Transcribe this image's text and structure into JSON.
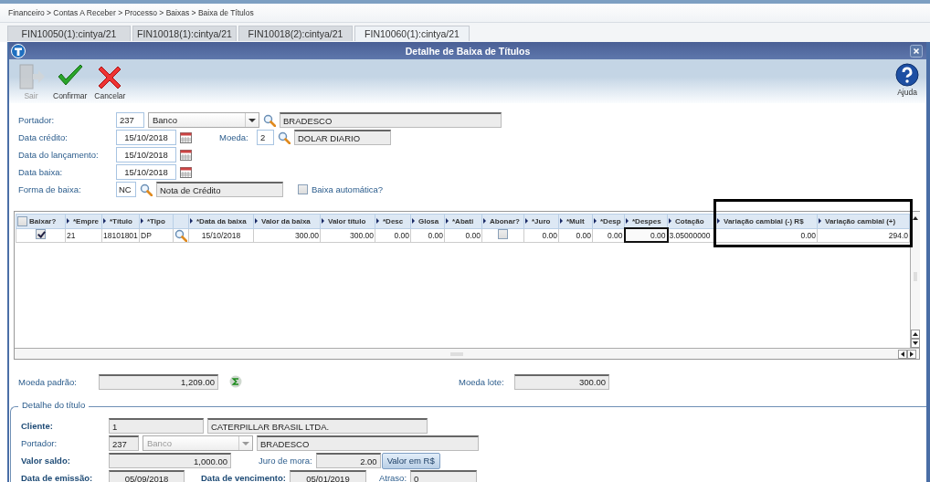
{
  "breadcrumb": "Financeiro > Contas A Receber > Processo > Baixas > Baixa de Títulos",
  "tabs": [
    {
      "label": "FIN10050(1):cintya/21",
      "selected": false
    },
    {
      "label": "FIN10018(1):cintya/21",
      "selected": false
    },
    {
      "label": "FIN10018(2):cintya/21",
      "selected": false
    },
    {
      "label": "FIN10060(1):cintya/21",
      "selected": true
    }
  ],
  "window": {
    "title": "Detalhe de Baixa de Títulos"
  },
  "toolbar": [
    {
      "kind": "exit",
      "label": "Sair",
      "disabled": true
    },
    {
      "kind": "confirm",
      "label": "Confirmar",
      "disabled": false
    },
    {
      "kind": "cancel",
      "label": "Cancelar",
      "disabled": false
    }
  ],
  "help": {
    "label": "Ajuda"
  },
  "form": [
    {
      "label": "Portador:",
      "items": [
        {
          "kind": "input",
          "value": "237"
        },
        {
          "kind": "select",
          "value": "Banco",
          "disabled": false
        },
        {
          "kind": "lookup"
        },
        {
          "kind": "readonly",
          "value": "BRADESCO"
        }
      ]
    },
    {
      "label": "Data crédito:",
      "items": [
        {
          "kind": "date",
          "value": "15/10/2018"
        },
        {
          "kind": "calendar"
        },
        {
          "kind": "label",
          "text": "Moeda:",
          "bold": false
        },
        {
          "kind": "input",
          "value": "2"
        },
        {
          "kind": "lookup"
        },
        {
          "kind": "readonly",
          "value": "DOLAR DIARIO"
        }
      ]
    },
    {
      "label": "Data do lançamento:",
      "items": [
        {
          "kind": "date",
          "value": "15/10/2018"
        },
        {
          "kind": "calendar"
        }
      ]
    },
    {
      "label": "Data baixa:",
      "items": [
        {
          "kind": "date",
          "value": "15/10/2018"
        },
        {
          "kind": "calendar"
        }
      ]
    },
    {
      "label": "Forma de  baixa:",
      "items": [
        {
          "kind": "input",
          "value": "NC"
        },
        {
          "kind": "lookup"
        },
        {
          "kind": "readonly",
          "value": "Nota de Crédito"
        },
        {
          "kind": "checkbox",
          "label": "Baixa automática?",
          "checked": false
        }
      ]
    }
  ],
  "grid": {
    "annotation_frame": true,
    "columns": [
      {
        "label": "Baixar?",
        "kind": "checkbox",
        "checked": false,
        "sort_arrow": false
      },
      {
        "label": "*Empre",
        "kind": "text",
        "sort_arrow": true
      },
      {
        "label": "*Título",
        "kind": "text",
        "sort_arrow": true
      },
      {
        "label": "*Tipo",
        "kind": "text",
        "sort_arrow": true
      },
      {
        "kind": "text",
        "sort_arrow": false
      },
      {
        "label": "*Data da baixa",
        "kind": "text",
        "sort_arrow": true
      },
      {
        "label": "Valor da baixa",
        "kind": "text",
        "sort_arrow": true
      },
      {
        "label": "Valor título",
        "kind": "text",
        "sort_arrow": true
      },
      {
        "label": "*Desc",
        "kind": "text",
        "sort_arrow": true
      },
      {
        "label": "Glosa",
        "kind": "text",
        "sort_arrow": true
      },
      {
        "label": "*Abati",
        "kind": "text",
        "sort_arrow": true
      },
      {
        "label": "Abonar?",
        "kind": "text",
        "sort_arrow": true
      },
      {
        "label": "*Juro",
        "kind": "text",
        "sort_arrow": true
      },
      {
        "label": "*Mult",
        "kind": "text",
        "sort_arrow": true
      },
      {
        "label": "*Desp",
        "kind": "text",
        "sort_arrow": true
      },
      {
        "label": "*Despes",
        "kind": "text",
        "sort_arrow": true
      },
      {
        "label": "Cotação",
        "kind": "text",
        "sort_arrow": true
      },
      {
        "label": "Variação cambial (-) R$",
        "kind": "text",
        "sort_arrow": true
      },
      {
        "label": "Variação cambial (+)",
        "kind": "text",
        "sort_arrow": true
      }
    ],
    "rows": [
      {
        "cells": [
          {
            "kind": "checkbox",
            "checked": true
          },
          {
            "kind": "text",
            "text": "21",
            "focused": false
          },
          {
            "kind": "text",
            "text": "18101801",
            "focused": false
          },
          {
            "kind": "text",
            "text": "DP",
            "focused": false
          },
          {
            "kind": "lookup"
          },
          {
            "kind": "text",
            "text": "15/10/2018",
            "focused": false
          },
          {
            "kind": "text",
            "text": "300.00",
            "focused": false
          },
          {
            "kind": "text",
            "text": "300.00",
            "focused": false
          },
          {
            "kind": "text",
            "text": "0.00",
            "focused": false
          },
          {
            "kind": "text",
            "text": "0.00",
            "focused": false
          },
          {
            "kind": "text",
            "text": "0.00",
            "focused": false
          },
          {
            "kind": "checkbox",
            "checked": false
          },
          {
            "kind": "text",
            "text": "0.00",
            "focused": false
          },
          {
            "kind": "text",
            "text": "0.00",
            "focused": false
          },
          {
            "kind": "text",
            "text": "0.00",
            "focused": false
          },
          {
            "kind": "text",
            "text": "0.00",
            "focused": true
          },
          {
            "kind": "text",
            "text": "3.05000000",
            "focused": false
          },
          {
            "kind": "text",
            "text": "0.00",
            "focused": false
          },
          {
            "kind": "text",
            "text": "294.0",
            "focused": false
          }
        ]
      }
    ]
  },
  "totals": [
    {
      "label": "Moeda padrão:",
      "value": "1,209.00",
      "sum_icon": true
    },
    {
      "label": "Moeda lote:",
      "value": "300.00",
      "sum_icon": false
    }
  ],
  "detail": {
    "legend": "Detalhe do título",
    "rows": [
      {
        "label": "Cliente:",
        "bold": true,
        "items": [
          {
            "kind": "readonly",
            "value": "1"
          },
          {
            "kind": "readonly",
            "value": "CATERPILLAR BRASIL LTDA."
          }
        ]
      },
      {
        "label": "Portador:",
        "bold": false,
        "items": [
          {
            "kind": "readonly",
            "value": "237"
          },
          {
            "kind": "select",
            "value": "Banco",
            "disabled": true
          },
          {
            "kind": "readonly",
            "value": "BRADESCO"
          }
        ]
      },
      {
        "label": "Valor saldo:",
        "bold": true,
        "items": [
          {
            "kind": "readonly",
            "value": "1,000.00"
          },
          {
            "kind": "label",
            "text": "Juro de mora:",
            "bold": false
          },
          {
            "kind": "readonly",
            "value": "2.00"
          },
          {
            "kind": "button",
            "text": "Valor em R$"
          }
        ]
      },
      {
        "label": "Data de emissão:",
        "bold": true,
        "items": [
          {
            "kind": "readonly",
            "value": "05/09/2018"
          },
          {
            "kind": "label",
            "text": "Data de vencimento:",
            "bold": true
          },
          {
            "kind": "readonly",
            "value": "05/01/2019"
          },
          {
            "kind": "label",
            "text": "Atraso:",
            "bold": false
          },
          {
            "kind": "readonly",
            "value": "0"
          }
        ]
      }
    ]
  }
}
